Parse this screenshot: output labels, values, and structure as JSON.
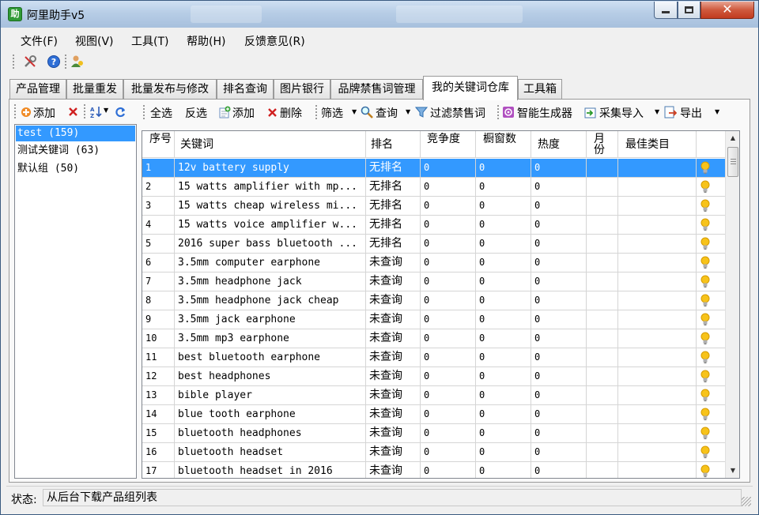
{
  "window": {
    "title": "阿里助手v5",
    "app_icon_text": "助"
  },
  "menu": [
    "文件(F)",
    "视图(V)",
    "工具(T)",
    "帮助(H)",
    "反馈意见(R)"
  ],
  "quick_icons": [
    "tools-icon",
    "help-icon",
    "user-icon"
  ],
  "tabs": [
    "产品管理",
    "批量重发",
    "批量发布与修改",
    "排名查询",
    "图片银行",
    "品牌禁售词管理",
    "我的关键词仓库",
    "工具箱"
  ],
  "active_tab": 6,
  "left_toolbar": {
    "add": "添加"
  },
  "groups": [
    {
      "label": "test (159)",
      "selected": true
    },
    {
      "label": "测试关键词 (63)",
      "selected": false
    },
    {
      "label": "默认组 (50)",
      "selected": false
    }
  ],
  "toolbar": {
    "select_all": "全选",
    "invert": "反选",
    "add": "添加",
    "delete": "删除",
    "filter": "筛选",
    "query": "查询",
    "filter_banned": "过滤禁售词",
    "smart_gen": "智能生成器",
    "collect_import": "采集导入",
    "export": "导出"
  },
  "columns": [
    "序号",
    "关键词",
    "排名",
    "竞争度",
    "橱窗数",
    "热度",
    "月份",
    "最佳类目"
  ],
  "rows": [
    [
      "1",
      "12v battery supply",
      "无排名",
      "0",
      "0",
      "0",
      "",
      ""
    ],
    [
      "2",
      "15 watts amplifier with mp...",
      "无排名",
      "0",
      "0",
      "0",
      "",
      ""
    ],
    [
      "3",
      "15 watts cheap wireless mi...",
      "无排名",
      "0",
      "0",
      "0",
      "",
      ""
    ],
    [
      "4",
      "15 watts voice amplifier w...",
      "无排名",
      "0",
      "0",
      "0",
      "",
      ""
    ],
    [
      "5",
      "2016 super bass bluetooth ...",
      "无排名",
      "0",
      "0",
      "0",
      "",
      ""
    ],
    [
      "6",
      "3.5mm computer earphone",
      "未查询",
      "0",
      "0",
      "0",
      "",
      ""
    ],
    [
      "7",
      "3.5mm headphone jack",
      "未查询",
      "0",
      "0",
      "0",
      "",
      ""
    ],
    [
      "8",
      "3.5mm headphone jack cheap",
      "未查询",
      "0",
      "0",
      "0",
      "",
      ""
    ],
    [
      "9",
      "3.5mm jack earphone",
      "未查询",
      "0",
      "0",
      "0",
      "",
      ""
    ],
    [
      "10",
      "3.5mm mp3 earphone",
      "未查询",
      "0",
      "0",
      "0",
      "",
      ""
    ],
    [
      "11",
      "best bluetooth earphone",
      "未查询",
      "0",
      "0",
      "0",
      "",
      ""
    ],
    [
      "12",
      "best headphones",
      "未查询",
      "0",
      "0",
      "0",
      "",
      ""
    ],
    [
      "13",
      "bible player",
      "未查询",
      "0",
      "0",
      "0",
      "",
      ""
    ],
    [
      "14",
      "blue tooth earphone",
      "未查询",
      "0",
      "0",
      "0",
      "",
      ""
    ],
    [
      "15",
      "bluetooth headphones",
      "未查询",
      "0",
      "0",
      "0",
      "",
      ""
    ],
    [
      "16",
      "bluetooth headset",
      "未查询",
      "0",
      "0",
      "0",
      "",
      ""
    ],
    [
      "17",
      "bluetooth headset in 2016",
      "未查询",
      "0",
      "0",
      "0",
      "",
      ""
    ]
  ],
  "selected_row": 0,
  "status": {
    "label": "状态:",
    "value": "从后台下载产品组列表"
  },
  "colors": {
    "selection": "#3399ff",
    "titlebar": "#b7cde6",
    "close": "#c13a1e"
  }
}
